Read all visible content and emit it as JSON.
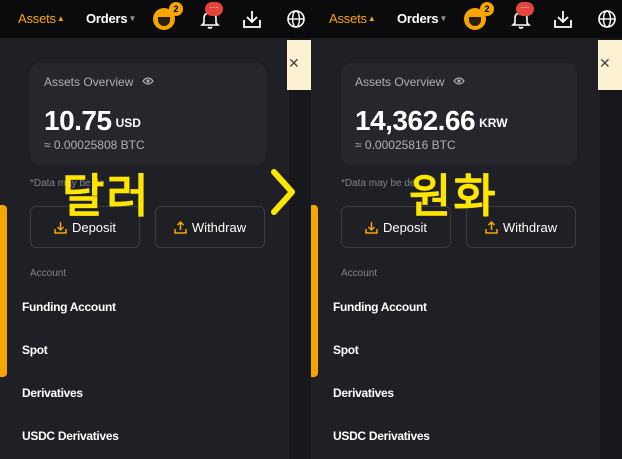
{
  "colors": {
    "accent": "#f7a600",
    "panel": "#17181c",
    "sidebar": "#1f2025",
    "card": "#26272d",
    "highlight": "#ffe600",
    "alert": "#e2463a"
  },
  "left": {
    "nav": {
      "assets": "Assets",
      "orders": "Orders"
    },
    "badges": {
      "notify_count": "2",
      "bell_dots": "···"
    },
    "card": {
      "title": "Assets Overview",
      "amount": "10.75",
      "currency": "USD",
      "approx": "≈ 0.00025808 BTC"
    },
    "delay_note": "*Data may be de",
    "buttons": {
      "deposit": "Deposit",
      "withdraw": "Withdraw"
    },
    "section": "Account",
    "accounts": [
      "Funding Account",
      "Spot",
      "Derivatives",
      "USDC Derivatives"
    ],
    "overlay": "달러"
  },
  "right": {
    "nav": {
      "assets": "Assets",
      "orders": "Orders"
    },
    "badges": {
      "notify_count": "2",
      "bell_dots": "···"
    },
    "card": {
      "title": "Assets Overview",
      "amount": "14,362.66",
      "currency": "KRW",
      "approx": "≈ 0.00025816 BTC"
    },
    "delay_note": "*Data may be de",
    "buttons": {
      "deposit": "Deposit",
      "withdraw": "Withdraw"
    },
    "section": "Account",
    "accounts": [
      "Funding Account",
      "Spot",
      "Derivatives",
      "USDC Derivatives"
    ],
    "overlay": "원화"
  },
  "icons": [
    "avatar-icon",
    "bell-icon",
    "download-icon",
    "globe-icon",
    "eye-icon",
    "close-icon",
    "deposit-icon",
    "withdraw-icon",
    "chevron-right-icon"
  ]
}
